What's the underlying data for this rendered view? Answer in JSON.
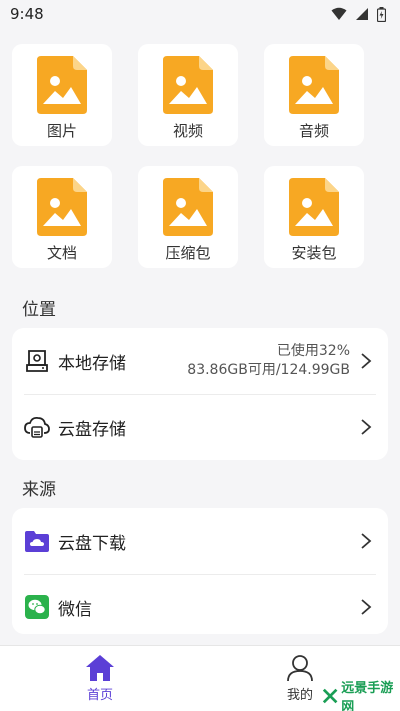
{
  "status_bar": {
    "time": "9:48"
  },
  "categories": [
    {
      "label": "图片",
      "icon": "image-file-icon"
    },
    {
      "label": "视频",
      "icon": "image-file-icon"
    },
    {
      "label": "音频",
      "icon": "image-file-icon"
    },
    {
      "label": "文档",
      "icon": "image-file-icon"
    },
    {
      "label": "压缩包",
      "icon": "image-file-icon"
    },
    {
      "label": "安装包",
      "icon": "image-file-icon"
    }
  ],
  "location": {
    "title": "位置",
    "items": [
      {
        "label": "本地存储",
        "usage": "已使用32%",
        "capacity": "83.86GB可用/124.99GB",
        "icon": "hard-drive-icon"
      },
      {
        "label": "云盘存储",
        "icon": "cloud-drive-icon"
      }
    ]
  },
  "source": {
    "title": "来源",
    "items": [
      {
        "label": "云盘下载",
        "icon": "cloud-folder-icon"
      },
      {
        "label": "微信",
        "icon": "wechat-icon"
      }
    ]
  },
  "bottom_nav": {
    "home": "首页",
    "mine": "我的"
  },
  "watermark": "远景手游网",
  "colors": {
    "accent": "#5b3fd6",
    "file_icon": "#f7a823",
    "wechat": "#2bb24c"
  }
}
